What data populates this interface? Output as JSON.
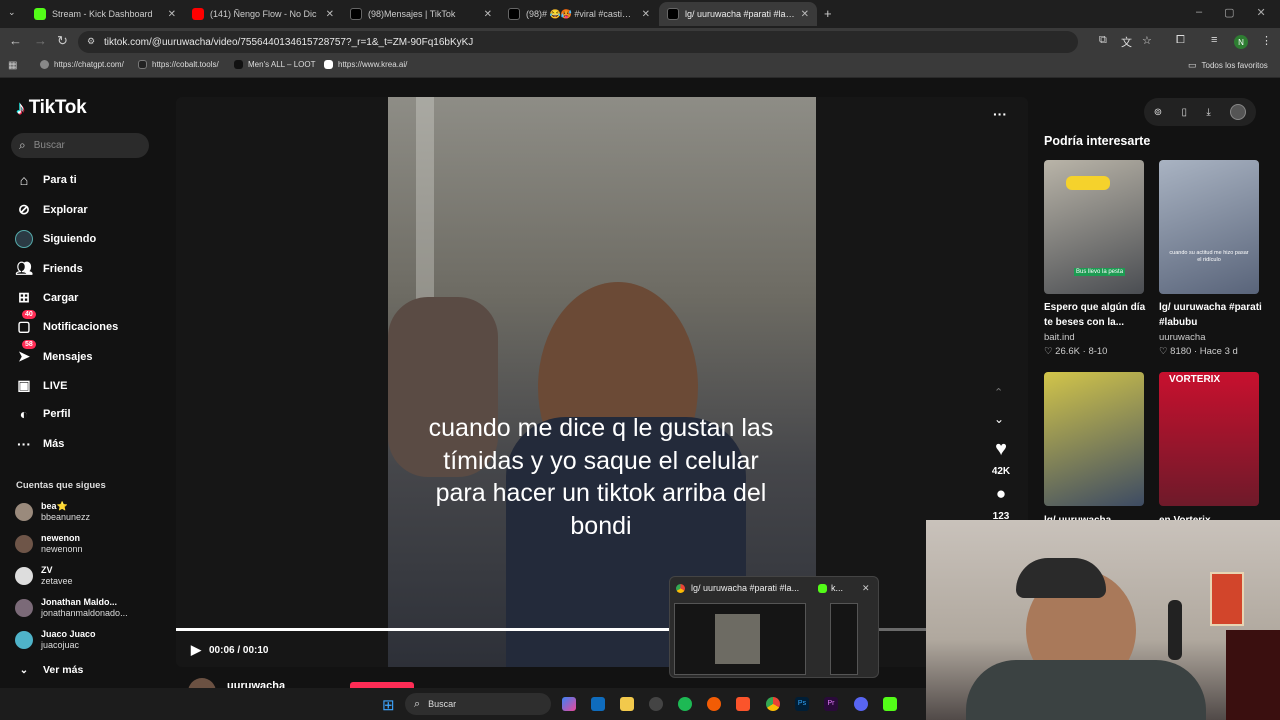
{
  "browser": {
    "tabs": [
      {
        "label": "Stream - Kick Dashboard",
        "icon": "kick-icon",
        "color": "#53fc18"
      },
      {
        "label": "(141) Ñengo Flow - No Dic",
        "icon": "youtube-icon",
        "color": "#ff0000"
      },
      {
        "label": "(98)Mensajes | TikTok",
        "icon": "tiktok-icon",
        "color": "#000000"
      },
      {
        "label": "(98)# 😂🥵 #viral #castigofant",
        "icon": "tiktok-icon",
        "color": "#000000"
      },
      {
        "label": "lg/ uuruwacha #parati #labu",
        "icon": "tiktok-icon",
        "color": "#000000"
      }
    ],
    "url": "tiktok.com/@uuruwacha/video/7556440134615728757?_r=1&_t=ZM-90Fq16bKyKJ",
    "bookmarks": [
      "https://chatgpt.com/",
      "https://cobalt.tools/",
      "Men's ALL – LOOT",
      "https://www.krea.ai/"
    ],
    "all_bookmarks": "Todos los favoritos",
    "profile_initial": "N"
  },
  "tiktok": {
    "logo": "TikTok",
    "search_placeholder": "Buscar",
    "nav": [
      {
        "label": "Para ti",
        "icon": "home-icon"
      },
      {
        "label": "Explorar",
        "icon": "compass-icon"
      },
      {
        "label": "Siguiendo",
        "icon": "following-icon"
      },
      {
        "label": "Friends",
        "icon": "friends-icon"
      },
      {
        "label": "Cargar",
        "icon": "upload-icon"
      },
      {
        "label": "Notificaciones",
        "icon": "bell-icon",
        "badge": "40"
      },
      {
        "label": "Mensajes",
        "icon": "message-icon",
        "badge": "58"
      },
      {
        "label": "LIVE",
        "icon": "live-icon"
      },
      {
        "label": "Perfil",
        "icon": "profile-icon"
      },
      {
        "label": "Más",
        "icon": "more-icon"
      }
    ],
    "following_title": "Cuentas que sigues",
    "following": [
      {
        "name": "bea⭐",
        "handle": "bbeanunezz"
      },
      {
        "name": "newenon",
        "handle": "newenonn"
      },
      {
        "name": "ZV",
        "handle": "zetavee"
      },
      {
        "name": "Jonathan Maldo...",
        "handle": "jonathanmaldonado..."
      },
      {
        "name": "Juaco Juaco",
        "handle": "juacojuac"
      }
    ],
    "see_more": "Ver más",
    "video": {
      "caption": "cuando me dice q le gustan las tímidas y yo saque el celular para hacer un tiktok arriba del bondi",
      "time": "00:06 / 00:10",
      "progress": 0.6,
      "likes": "42K",
      "comments": "123",
      "author": "uuruwacha"
    },
    "recommend_title": "Podría interesarte",
    "cards": [
      {
        "title": "Espero que algún día te beses con la...",
        "author": "bait.ind",
        "likes": "26.6K",
        "date": "8-10",
        "thumb_text": "Bus llevo la pesta"
      },
      {
        "title": "lg/ uuruwacha #parati #labubu",
        "author": "uuruwacha",
        "likes": "8180",
        "date": "Hace 3 d",
        "thumb_text": "cuando su actitud me hizo pasar el ridículo"
      },
      {
        "title": "lg/ uuruwacha",
        "author": "",
        "likes": "",
        "date": "",
        "thumb_text": ""
      },
      {
        "title": "en Vorterix",
        "author": "",
        "likes": "",
        "date": "",
        "thumb_text": "VORTERIX"
      }
    ]
  },
  "taskbar": {
    "search": "Buscar",
    "preview_title": "lg/ uuruwacha #parati #la...",
    "preview_second": "k..."
  }
}
